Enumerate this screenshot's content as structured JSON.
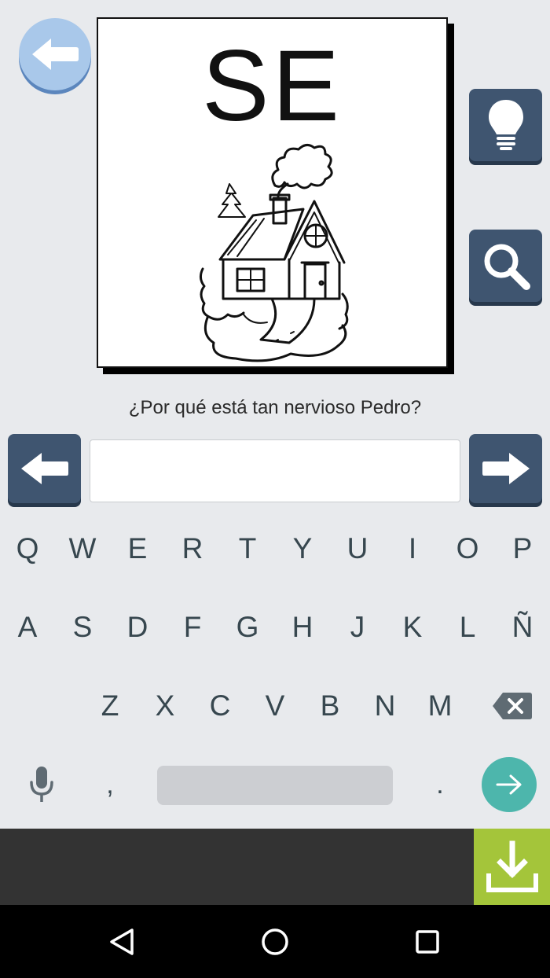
{
  "card": {
    "syllable": "SE",
    "illustration": "house-with-chimney-smoke"
  },
  "question": "¿Por qué está tan nervioso Pedro?",
  "answer_input": {
    "value": "",
    "placeholder": ""
  },
  "keyboard": {
    "row1": [
      "Q",
      "W",
      "E",
      "R",
      "T",
      "Y",
      "U",
      "I",
      "O",
      "P"
    ],
    "row2": [
      "A",
      "S",
      "D",
      "F",
      "G",
      "H",
      "J",
      "K",
      "L",
      "Ñ"
    ],
    "row3": [
      "Z",
      "X",
      "C",
      "V",
      "B",
      "N",
      "M"
    ],
    "comma": ",",
    "period": "."
  },
  "icons": {
    "back": "back-arrow-icon",
    "hint": "lightbulb-icon",
    "search": "magnifier-icon",
    "prev": "left-arrow-icon",
    "next": "right-arrow-icon",
    "backspace": "backspace-icon",
    "mic": "microphone-icon",
    "enter": "enter-arrow-icon",
    "download": "download-icon"
  },
  "colors": {
    "background": "#e8eaed",
    "button_dark": "#3f5570",
    "back_circle": "#a9c8ea",
    "enter_key": "#4db6ac",
    "download_green": "#a4c53a",
    "ad_bar": "#333333"
  }
}
